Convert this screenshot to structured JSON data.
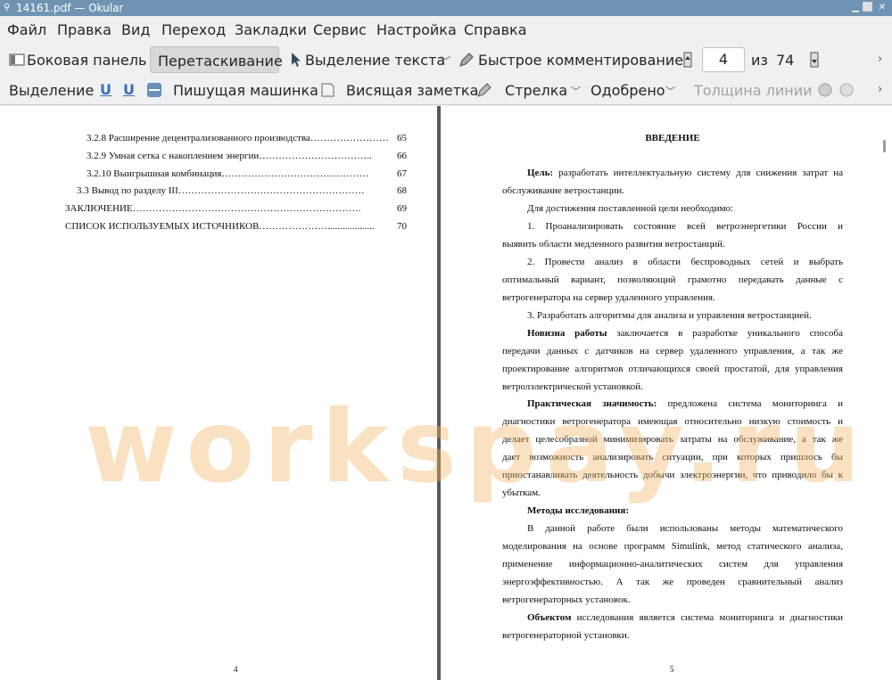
{
  "window": {
    "title": "14161.pdf — Okular",
    "min_glyph": "▁",
    "max_glyph": "⬜",
    "close_glyph": "✕"
  },
  "menubar": {
    "items": [
      "Файл",
      "Правка",
      "Вид",
      "Переход",
      "Закладки",
      "Сервис",
      "Настройка",
      "Справка"
    ]
  },
  "toolbar1": {
    "sidebar_label": "Боковая панель",
    "drag_label": "Перетаскивание",
    "text_select_label": "Выделение текста",
    "quick_annot_label": "Быстрое комментирование",
    "page_current": "4",
    "page_of": "из",
    "page_total": "74"
  },
  "toolbar2": {
    "select_label": "Выделение",
    "typewriter_label": "Пишущая машинка",
    "note_label": "Висящая заметка",
    "arrow_label": "Стрелка",
    "approved_label": "Одобрено",
    "linewidth_label": "Толщина линии"
  },
  "left_page": {
    "toc": [
      {
        "text": "3.2.8 Расширение децентрализованного производства……………………",
        "num": "65"
      },
      {
        "text": "3.2.9 Умная сетка с накоплением энергии……………………………..",
        "num": "66"
      },
      {
        "text": "3.2.10 Выигрышная комбинация………………………………………",
        "num": "67"
      },
      {
        "text": "3.3 Вывод по разделу III…………………………………………………",
        "num": "68"
      },
      {
        "text": "ЗАКЛЮЧЕНИЕ…………………………………………………………….",
        "num": "69"
      },
      {
        "text": "СПИСОК ИСПОЛЬЗУЕМЫХ ИСТОЧНИКОВ…………………...................",
        "num": "70"
      }
    ],
    "page_number": "4"
  },
  "right_page": {
    "heading": "ВВЕДЕНИЕ",
    "goal_bold": "Цель:",
    "goal_l1": " разработать интеллектуальную систему для снижения затрат на",
    "goal_l2": "обслуживание ветростанции.",
    "need_line": "Для достижения поставленной цели необходимо:",
    "item1_l1": "1.       Проанализировать состояние всей ветроэнергетики России и",
    "item1_l2": "выявить области медленного развития ветростанций.",
    "item2_l1": "2.       Провести анализ в области беспроводных сетей и выбрать",
    "item2_l2": "оптимальный вариант, позволяющий грамотно передавать данные с",
    "item2_l3": "ветрогенератора на сервер удаленного управления.",
    "item3_l1": "3.       Разработать алгоритмы для анализа и управления ветростанцией.",
    "novelty_bold": "Новизна работы",
    "novelty_l1": " заключается в разработке уникального способа",
    "novelty_l2": "передачи данных с датчиков на сервер удаленного управления, а так же",
    "novelty_l3": "проектирование алгоритмов отличающихся своей простатой, для управления",
    "novelty_l4": "ветролэлектрической установкой.",
    "practical_bold": "Практическая значимость:",
    "practical_l1": " предложена система мониторинга и",
    "practical_l2": "диагностики ветрогенератора имеющая относительно низкую стоимость и",
    "practical_l3": "делает целесобразной минимизировать затраты на обслуживание, а так же",
    "practical_l4": "дает возможность анализировать ситуации, при которых пришлось бы",
    "practical_l5": "приостанавливать деятельность добычи электроэнергии, что приводило бы к",
    "practical_l6": "убыткам.",
    "methods_bold": "Методы исследования:",
    "methods_l1": "В данной работе были использованы методы математического",
    "methods_l2": "моделирования на основе программ Simulink, метод статического анализа,",
    "methods_l3": "применение информационно-аналитических систем для управления",
    "methods_l4": "энергоэффективностью. А так же проведен сравнительный анализ",
    "methods_l5": "ветрогенераторных установок.",
    "object_bold": "Объектом",
    "object_l1": " исследования является система мониторинга и диагностики",
    "object_l2": "ветрогенераторной установки.",
    "page_number": "5"
  },
  "watermark": "workspay.ru"
}
